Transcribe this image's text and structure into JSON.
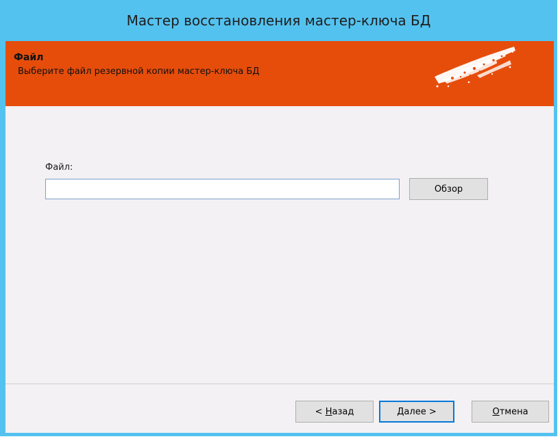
{
  "window": {
    "title": "Мастер восстановления мастер-ключа БД"
  },
  "banner": {
    "title": "Файл",
    "subtitle": "Выберите файл резервной копии мастер-ключа БД",
    "logo_icon": "brush-stroke-logo"
  },
  "form": {
    "file_label": "Файл:",
    "file_value": "",
    "file_placeholder": "",
    "browse_label": "Обзор"
  },
  "footer": {
    "back": {
      "prefix": "< ",
      "mnemonic": "Н",
      "rest": "азад"
    },
    "next": {
      "mnemonic": "Д",
      "rest": "алее >"
    },
    "cancel": {
      "mnemonic": "О",
      "rest": "тмена"
    }
  },
  "colors": {
    "frame": "#54c2ef",
    "banner": "#e64d0b",
    "client": "#f4f1f4",
    "default_button_border": "#0078d7"
  }
}
